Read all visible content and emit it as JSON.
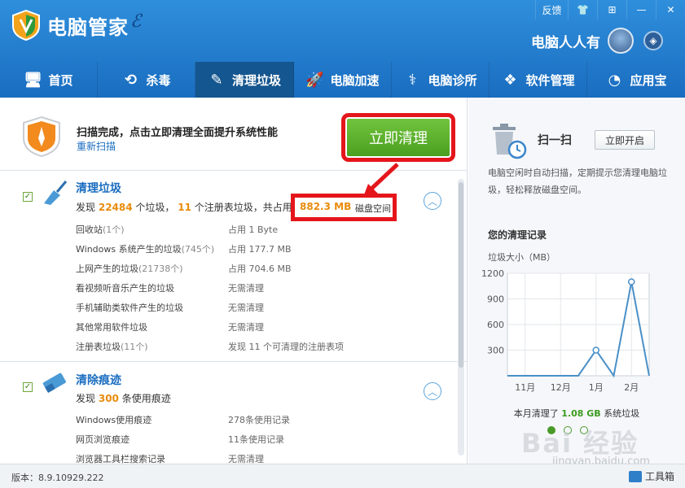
{
  "app": {
    "title": "电脑管家",
    "user": "电脑人人有"
  },
  "winbar": {
    "feedback": "反馈",
    "skin": "👕",
    "menu": "⊞",
    "minimize": "—",
    "close": "✕"
  },
  "nav": [
    {
      "label": "首页",
      "icon": "🖥"
    },
    {
      "label": "杀毒",
      "icon": "⟲"
    },
    {
      "label": "清理垃圾",
      "icon": "✎"
    },
    {
      "label": "电脑加速",
      "icon": "🚀"
    },
    {
      "label": "电脑诊所",
      "icon": "⚕"
    },
    {
      "label": "软件管理",
      "icon": "❖"
    },
    {
      "label": "应用宝",
      "icon": "◔"
    }
  ],
  "banner": {
    "title": "扫描完成，点击立即清理全面提升系统性能",
    "rescan": "重新扫描",
    "clean_button": "立即清理"
  },
  "junk": {
    "title": "清理垃圾",
    "summary_prefix": "发现",
    "file_count": "22484",
    "mid1": "个垃圾，",
    "reg_count": "11",
    "mid2": "个注册表垃圾，共占用",
    "total_size": "882.3 MB",
    "suffix": "磁盘空间",
    "rows": [
      {
        "name": "回收站",
        "count": "(1个)",
        "value": "占用 1 Byte"
      },
      {
        "name": "Windows 系统产生的垃圾",
        "count": "(745个)",
        "value": "占用 177.7 MB"
      },
      {
        "name": "上网产生的垃圾",
        "count": "(21738个)",
        "value": "占用 704.6 MB"
      },
      {
        "name": "看视频听音乐产生的垃圾",
        "count": "",
        "value": "无需清理"
      },
      {
        "name": "手机辅助类软件产生的垃圾",
        "count": "",
        "value": "无需清理"
      },
      {
        "name": "其他常用软件垃圾",
        "count": "",
        "value": "无需清理"
      },
      {
        "name": "注册表垃圾",
        "count": "(11个)",
        "value": "发现 11 个可清理的注册表项"
      }
    ]
  },
  "traces": {
    "title": "清除痕迹",
    "summary_prefix": "发现",
    "count": "300",
    "suffix": "条使用痕迹",
    "rows": [
      {
        "name": "Windows使用痕迹",
        "value": "278条使用记录"
      },
      {
        "name": "网页浏览痕迹",
        "value": "11条使用记录"
      },
      {
        "name": "浏览器工具栏搜索记录",
        "value": "无需清理"
      }
    ]
  },
  "sidebar": {
    "title": "扫一扫",
    "enable_button": "立即开启",
    "desc": "电脑空闲时自动扫描，定期提示您清理电脑垃圾，轻松释放磁盘空间。",
    "records_title": "您的清理记录",
    "chart_ylabel": "垃圾大小（MB）",
    "monthly_prefix": "本月清理了",
    "monthly_value": "1.08 GB",
    "monthly_suffix": "系统垃圾"
  },
  "chart_data": {
    "type": "line",
    "categories": [
      "11月",
      "12月",
      "1月",
      "2月"
    ],
    "x": [
      "",
      "11月",
      "",
      "12月",
      "",
      "1月",
      "",
      "2月",
      ""
    ],
    "values": [
      0,
      0,
      0,
      0,
      0,
      300,
      0,
      1100,
      0
    ],
    "yticks": [
      300,
      600,
      900,
      1200
    ],
    "ylim": [
      0,
      1200
    ],
    "ylabel": "垃圾大小（MB）",
    "grid": true,
    "color": "#4a90c8"
  },
  "watermark": {
    "text": "Bai 经验",
    "sub": "jingyan.baidu.com"
  },
  "status": {
    "version": "版本：8.9.10929.222",
    "toolbox": "工具箱"
  },
  "colors": {
    "accent": "#1a6dc0",
    "highlight": "#e4161b",
    "clean_green": "#5cb22c",
    "orange": "#e98b0c"
  }
}
